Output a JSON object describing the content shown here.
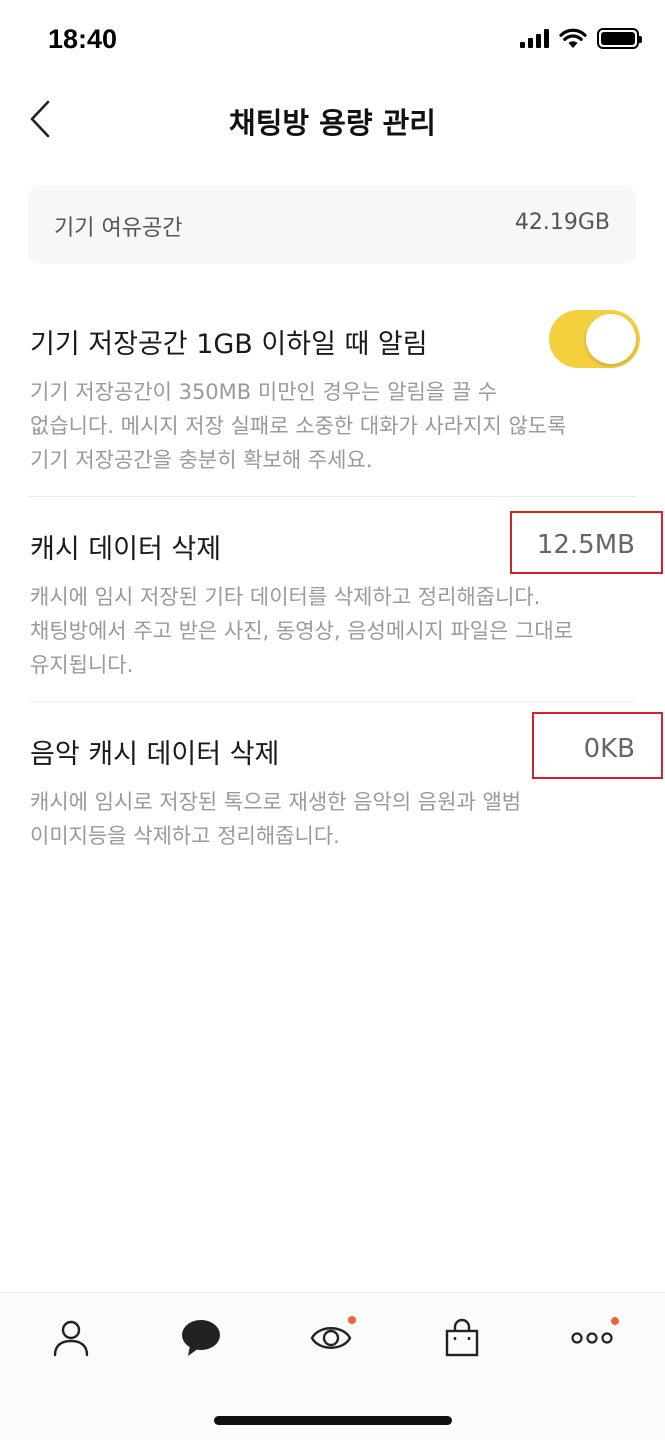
{
  "status_bar": {
    "time": "18:40",
    "icons": [
      "signal-icon",
      "wifi-icon",
      "battery-icon"
    ]
  },
  "nav": {
    "back_icon": "chevron-left-icon",
    "title": "채팅방 용량 관리"
  },
  "storage": {
    "label": "기기 여유공간",
    "value": "42.19GB"
  },
  "low_storage_alert": {
    "title": "기기 저장공간 1GB 이하일 때 알림",
    "toggle_on": true,
    "toggle_color": "#f4cf3e",
    "description_lines": [
      "기기 저장공간이 350MB 미만인 경우는 알림을 끌 수",
      "없습니다. 메시지 저장 실패로 소중한 대화가 사라지지 않도록",
      "기기 저장공간을 충분히 확보해 주세요."
    ]
  },
  "cache_delete": {
    "title": "캐시 데이터 삭제",
    "value": "12.5MB",
    "description_lines": [
      "캐시에 임시 저장된 기타 데이터를 삭제하고 정리해줍니다.",
      "채팅방에서 주고 받은 사진, 동영상, 음성메시지 파일은 그대로",
      "유지됩니다."
    ]
  },
  "music_cache_delete": {
    "title": "음악 캐시 데이터 삭제",
    "value": "0KB",
    "description_lines": [
      "캐시에 임시로 저장된 톡으로 재생한 음악의 음원과 앨범",
      "이미지등을 삭제하고 정리해줍니다."
    ]
  },
  "highlight_color": "#d3222e",
  "tab_bar": {
    "tabs": [
      {
        "icon": "person-icon",
        "badge": false
      },
      {
        "icon": "chat-bubble-icon",
        "badge": false
      },
      {
        "icon": "view-eye-icon",
        "badge": true
      },
      {
        "icon": "shopping-bag-icon",
        "badge": false
      },
      {
        "icon": "more-dots-icon",
        "badge": true
      }
    ],
    "badge_color": "#f0663c"
  }
}
